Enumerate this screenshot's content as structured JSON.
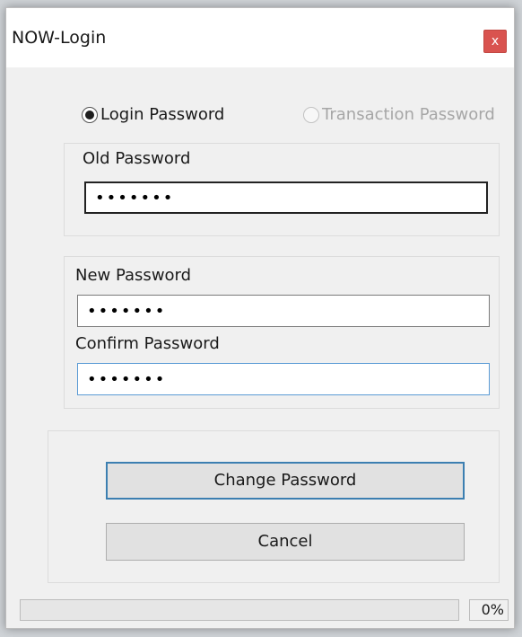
{
  "window": {
    "title": "NOW-Login",
    "close_label": "x"
  },
  "password_type": {
    "options": [
      {
        "label": "Login Password",
        "selected": true,
        "enabled": true
      },
      {
        "label": "Transaction Password",
        "selected": false,
        "enabled": false
      }
    ]
  },
  "old_password": {
    "label": "Old Password",
    "value": "•••••••"
  },
  "new_password": {
    "label": "New Password",
    "value": "•••••••"
  },
  "confirm_password": {
    "label": "Confirm Password",
    "value": "•••••••"
  },
  "buttons": {
    "change": "Change Password",
    "cancel": "Cancel"
  },
  "status": {
    "progress_percent_text": "0%",
    "progress_fraction": 0
  },
  "colors": {
    "close_button": "#d9534f",
    "focus_border": "#5b9bd5",
    "default_button_border": "#3c7fb1"
  }
}
